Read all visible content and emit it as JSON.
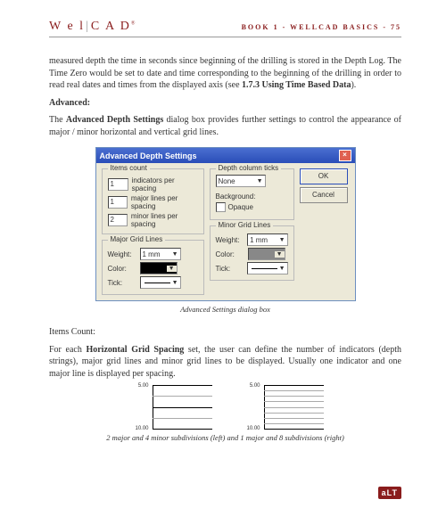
{
  "header": {
    "logo_pre": "W e l",
    "logo_post": "C A D",
    "right": "BOOK 1 - WELLCAD BASICS - 75"
  },
  "para1": "measured depth the time in seconds since beginning of the drilling is stored in the Depth Log. The Time Zero would be set to date and time corresponding to the beginning of the drilling in order to read real dates and times from the displayed axis (see ",
  "para1_bold": "1.7.3 Using Time Based Data",
  "para1_tail": ").",
  "adv_label": "Advanced:",
  "para2_a": "The ",
  "para2_bold": "Advanced Depth Settings",
  "para2_b": " dialog box provides further settings to control the appearance of major / minor horizontal and vertical grid lines.",
  "dialog": {
    "title": "Advanced Depth Settings",
    "items_count": "Items count",
    "ind_val": "1",
    "ind_lbl": "indicators per spacing",
    "maj_val": "1",
    "maj_lbl": "major lines per spacing",
    "min_val": "2",
    "min_lbl": "minor lines per spacing",
    "ticks_grp": "Depth column ticks",
    "ticks_sel": "None",
    "bg_lbl": "Background:",
    "opaque": "Opaque",
    "ok": "OK",
    "cancel": "Cancel",
    "major_grid": "Major Grid Lines",
    "minor_grid": "Minor Grid Lines",
    "weight": "Weight:",
    "color": "Color:",
    "tick": "Tick:",
    "wval": "1 mm"
  },
  "caption1": "Advanced Settings dialog box",
  "items_count_h": "Items Count:",
  "para3_a": "For each ",
  "para3_bold": "Horizontal Grid Spacing",
  "para3_b": " set, the user can define the number of indicators (depth strings), major grid lines and minor grid lines to be displayed. Usually one indicator and one major line is displayed per spacing.",
  "sub": {
    "n1": "5.00",
    "n2": "10.00"
  },
  "caption2": "2 major and 4 minor subdivisions (left) and 1 major and 8 subdivisions (right)",
  "footer": "aLT"
}
